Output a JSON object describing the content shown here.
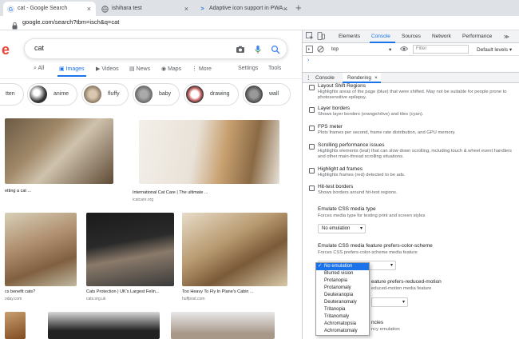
{
  "browser": {
    "tabs": [
      {
        "title": "cat - Google Search",
        "favicon": "G"
      },
      {
        "title": "ishihara test",
        "favicon": "globe"
      },
      {
        "title": "Adaptive icon support in PWA...",
        "favicon": ">"
      }
    ],
    "close_glyph": "×",
    "new_tab_glyph": "+",
    "url": "google.com/search?tbm=isch&q=cat"
  },
  "google": {
    "logo_letter": "e",
    "query": "cat",
    "nav": {
      "all": "All",
      "images": "Images",
      "videos": "Videos",
      "news": "News",
      "maps": "Maps",
      "more": "More",
      "settings": "Settings",
      "tools": "Tools"
    },
    "chips": [
      "tten",
      "anime",
      "fluffy",
      "baby",
      "drawing",
      "wall"
    ],
    "results": [
      {
        "caption": "etting a cat ...",
        "source": ""
      },
      {
        "caption": "International Cat Care | The ultimate ...",
        "source": "icatcare.org"
      },
      {
        "caption": "cs benefit cats?",
        "source": "oday.com"
      },
      {
        "caption": "Cats Protection | UK's Largest Felin...",
        "source": "cats.org.uk"
      },
      {
        "caption": "Too Heavy To Fly In Plane's Cabin ...",
        "source": "huffpost.com"
      }
    ]
  },
  "devtools": {
    "tabs": {
      "elements": "Elements",
      "console": "Console",
      "sources": "Sources",
      "network": "Network",
      "performance": "Performance",
      "more": "≫"
    },
    "context": "top",
    "filter_placeholder": "Filter",
    "levels": "Default levels ▾",
    "drawer": {
      "console": "Console",
      "rendering": "Rendering",
      "close": "×"
    },
    "options": [
      {
        "title": "Layout Shift Regions",
        "desc": "Highlights areas of the page (blue) that were shifted. May not be suitable for people prone to photosensitive epilepsy."
      },
      {
        "title": "Layer borders",
        "desc": "Shows layer borders (orange/olive) and tiles (cyan)."
      },
      {
        "title": "FPS meter",
        "desc": "Plots frames per second, frame rate distribution, and GPU memory."
      },
      {
        "title": "Scrolling performance issues",
        "desc": "Highlights elements (teal) that can slow down scrolling, including touch & wheel event handlers and other main-thread scrolling situations."
      },
      {
        "title": "Highlight ad frames",
        "desc": "Highlights frames (red) detected to be ads."
      },
      {
        "title": "Hit-test borders",
        "desc": "Shows borders around hit-test regions."
      }
    ],
    "media_type": {
      "title": "Emulate CSS media type",
      "desc": "Forces media type for testing print and screen styles",
      "value": "No emulation"
    },
    "color_scheme": {
      "title": "Emulate CSS media feature prefers-color-scheme",
      "desc": "Forces CSS prefers-color-scheme media feature"
    },
    "reduced_motion": {
      "title_partial": "eature prefers-reduced-motion",
      "desc_partial": "educed-motion media feature"
    },
    "last_partial": {
      "title_partial": "ncies",
      "desc_partial": "ncy emulation"
    },
    "dropdown": {
      "items": [
        "No emulation",
        "Blurred vision",
        "Protanopia",
        "Protanomaly",
        "Deuteranopia",
        "Deuteranomaly",
        "Tritanopia",
        "Tritanomaly",
        "Achromatopsia",
        "Achromatomaly"
      ],
      "selected": "No emulation",
      "check": "✓"
    }
  },
  "colors": {
    "accent": "#1a73e8",
    "google_red": "#ea4335"
  }
}
